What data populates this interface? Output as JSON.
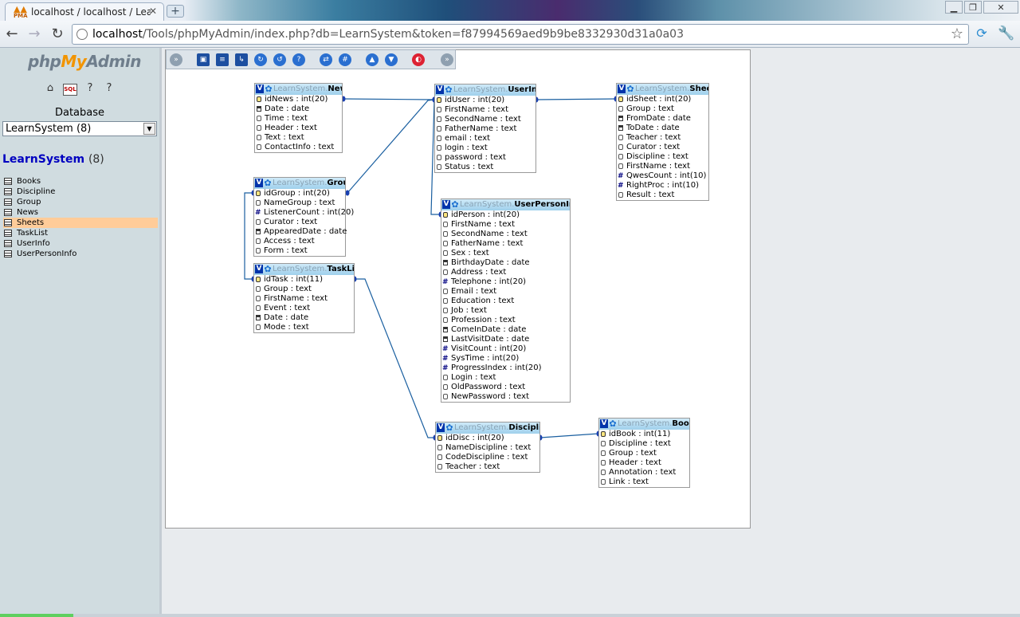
{
  "browser": {
    "tab_title": "localhost / localhost / LearnSystem",
    "favicon_text": "PMA",
    "url_host": "localhost",
    "url_rest": "/Tools/phpMyAdmin/index.php?db=LearnSystem&token=f87994569aed9b9be8332930d31a0a03"
  },
  "sidebar": {
    "logo_php": "php",
    "logo_my": "My",
    "logo_admin": "Admin",
    "database_label": "Database",
    "database_selected": "LearnSystem (8)",
    "db_name": "LearnSystem",
    "db_count": "(8)",
    "tables": [
      "Books",
      "Discipline",
      "Group",
      "News",
      "Sheets",
      "TaskList",
      "UserInfo",
      "UserPersonInfo"
    ],
    "active_table": "Sheets"
  },
  "designer": {
    "db_prefix": "LearnSystem.",
    "toolbar_icons": [
      "toggle-menu-icon",
      "save-icon",
      "table-list-icon",
      "relation-icon",
      "reload-icon",
      "help-icon",
      "question-icon",
      "angular-links-icon",
      "grid-icon",
      "collapse-icon",
      "expand-icon",
      "pdf-icon",
      "move-menu-icon"
    ],
    "tables": {
      "news": {
        "name": "News",
        "fields": [
          {
            "t": "key",
            "text": "idNews : int(20)"
          },
          {
            "t": "date",
            "text": "Date : date"
          },
          {
            "t": "text",
            "text": "Time : text"
          },
          {
            "t": "text",
            "text": "Header : text"
          },
          {
            "t": "text",
            "text": "Text : text"
          },
          {
            "t": "text",
            "text": "ContactInfo : text"
          }
        ]
      },
      "group": {
        "name": "Group",
        "fields": [
          {
            "t": "key",
            "text": "idGroup : int(20)"
          },
          {
            "t": "text",
            "text": "NameGroup : text"
          },
          {
            "t": "num",
            "text": "ListenerCount : int(20)"
          },
          {
            "t": "text",
            "text": "Curator : text"
          },
          {
            "t": "date",
            "text": "AppearedDate : date"
          },
          {
            "t": "text",
            "text": "Access : text"
          },
          {
            "t": "text",
            "text": "Form : text"
          }
        ]
      },
      "tasklist": {
        "name": "TaskList",
        "fields": [
          {
            "t": "key",
            "text": "idTask : int(11)"
          },
          {
            "t": "text",
            "text": "Group : text"
          },
          {
            "t": "text",
            "text": "FirstName : text"
          },
          {
            "t": "text",
            "text": "Event : text"
          },
          {
            "t": "date",
            "text": "Date : date"
          },
          {
            "t": "text",
            "text": "Mode : text"
          }
        ]
      },
      "userinfo": {
        "name": "UserInfo",
        "fields": [
          {
            "t": "key",
            "text": "idUser : int(20)"
          },
          {
            "t": "text",
            "text": "FirstName : text"
          },
          {
            "t": "text",
            "text": "SecondName : text"
          },
          {
            "t": "text",
            "text": "FatherName : text"
          },
          {
            "t": "text",
            "text": "email : text"
          },
          {
            "t": "text",
            "text": "login : text"
          },
          {
            "t": "text",
            "text": "password : text"
          },
          {
            "t": "text",
            "text": "Status : text"
          }
        ]
      },
      "userpersoninfo": {
        "name": "UserPersonInfo",
        "fields": [
          {
            "t": "key",
            "text": "idPerson : int(20)"
          },
          {
            "t": "text",
            "text": "FirstName : text"
          },
          {
            "t": "text",
            "text": "SecondName : text"
          },
          {
            "t": "text",
            "text": "FatherName : text"
          },
          {
            "t": "text",
            "text": "Sex : text"
          },
          {
            "t": "date",
            "text": "BirthdayDate : date"
          },
          {
            "t": "text",
            "text": "Address : text"
          },
          {
            "t": "num",
            "text": "Telephone : int(20)"
          },
          {
            "t": "text",
            "text": "Email : text"
          },
          {
            "t": "text",
            "text": "Education : text"
          },
          {
            "t": "text",
            "text": "Job : text"
          },
          {
            "t": "text",
            "text": "Profession : text"
          },
          {
            "t": "date",
            "text": "ComeInDate : date"
          },
          {
            "t": "date",
            "text": "LastVisitDate : date"
          },
          {
            "t": "num",
            "text": "VisitCount : int(20)"
          },
          {
            "t": "num",
            "text": "SysTime : int(20)"
          },
          {
            "t": "num",
            "text": "ProgressIndex : int(20)"
          },
          {
            "t": "text",
            "text": "Login : text"
          },
          {
            "t": "text",
            "text": "OldPassword : text"
          },
          {
            "t": "text",
            "text": "NewPassword : text"
          }
        ]
      },
      "sheets": {
        "name": "Sheets",
        "fields": [
          {
            "t": "key",
            "text": "idSheet : int(20)"
          },
          {
            "t": "text",
            "text": "Group : text"
          },
          {
            "t": "date",
            "text": "FromDate : date"
          },
          {
            "t": "date",
            "text": "ToDate : date"
          },
          {
            "t": "text",
            "text": "Teacher : text"
          },
          {
            "t": "text",
            "text": "Curator : text"
          },
          {
            "t": "text",
            "text": "Discipline : text"
          },
          {
            "t": "text",
            "text": "FirstName : text"
          },
          {
            "t": "num",
            "text": "QwesCount : int(10)"
          },
          {
            "t": "num",
            "text": "RightProc : int(10)"
          },
          {
            "t": "text",
            "text": "Result : text"
          }
        ]
      },
      "discipline": {
        "name": "Discipline",
        "fields": [
          {
            "t": "key",
            "text": "idDisc : int(20)"
          },
          {
            "t": "text",
            "text": "NameDiscipline : text"
          },
          {
            "t": "text",
            "text": "CodeDiscipline : text"
          },
          {
            "t": "text",
            "text": "Teacher : text"
          }
        ]
      },
      "books": {
        "name": "Books",
        "fields": [
          {
            "t": "key",
            "text": "idBook : int(11)"
          },
          {
            "t": "text",
            "text": "Discipline : text"
          },
          {
            "t": "text",
            "text": "Group : text"
          },
          {
            "t": "text",
            "text": "Header : text"
          },
          {
            "t": "text",
            "text": "Annotation : text"
          },
          {
            "t": "text",
            "text": "Link : text"
          }
        ]
      }
    }
  },
  "colors": {
    "link": "#1a5fa0",
    "header_start": "#cfeaf8",
    "header_end": "#9fd0ec",
    "active_row": "#ffcc99"
  }
}
